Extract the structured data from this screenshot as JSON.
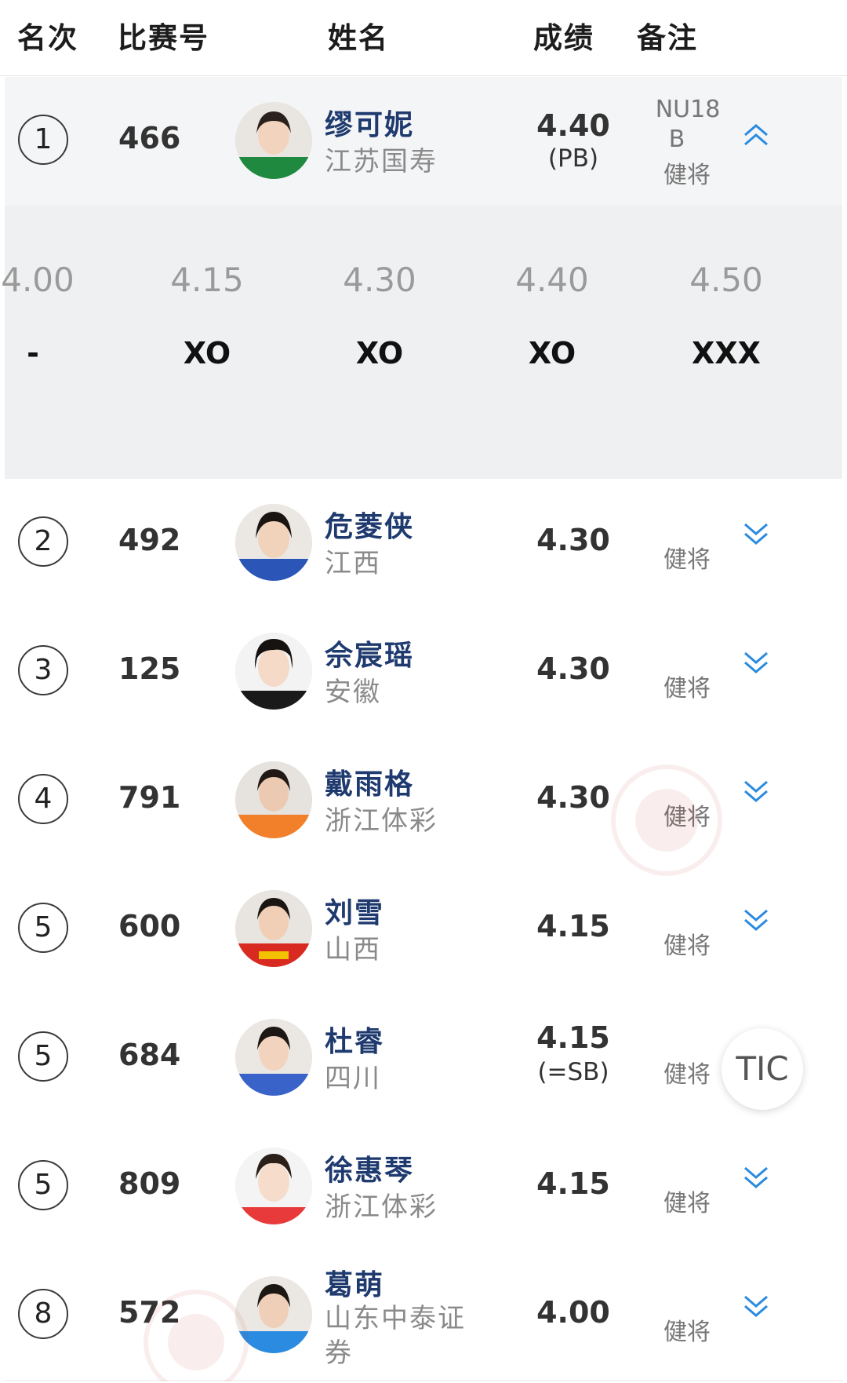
{
  "header": {
    "rank": "名次",
    "bib": "比赛号",
    "name": "姓名",
    "performance": "成绩",
    "remarks": "备注"
  },
  "expanded": {
    "heights": [
      "4.00",
      "4.15",
      "4.30",
      "4.40",
      "4.50"
    ],
    "marks": [
      "-",
      "XO",
      "XO",
      "XO",
      "XXX"
    ]
  },
  "rows": [
    {
      "rank": "1",
      "bib": "466",
      "name": "缪可妮",
      "team": "江苏国寿",
      "perf": "4.40",
      "perf_note": "(PB)",
      "remark1": "NU18",
      "remark2": "B",
      "remark3": "健将",
      "jersey": "#1f8a3f"
    },
    {
      "rank": "2",
      "bib": "492",
      "name": "危菱侠",
      "team": "江西",
      "perf": "4.30",
      "perf_note": "",
      "remark3": "健将",
      "jersey": "#2b56b8"
    },
    {
      "rank": "3",
      "bib": "125",
      "name": "佘宸瑶",
      "team": "安徽",
      "perf": "4.30",
      "perf_note": "",
      "remark3": "健将",
      "jersey": "#1a1a1a"
    },
    {
      "rank": "4",
      "bib": "791",
      "name": "戴雨格",
      "team": "浙江体彩",
      "perf": "4.30",
      "perf_note": "",
      "remark3": "健将",
      "jersey": "#f2802a"
    },
    {
      "rank": "5",
      "bib": "600",
      "name": "刘雪",
      "team": "山西",
      "perf": "4.15",
      "perf_note": "",
      "remark3": "健将",
      "jersey": "#d92a22"
    },
    {
      "rank": "5",
      "bib": "684",
      "name": "杜睿",
      "team": "四川",
      "perf": "4.15",
      "perf_note": "(=SB)",
      "remark3": "健将",
      "jersey": "#3a63c9"
    },
    {
      "rank": "5",
      "bib": "809",
      "name": "徐惠琴",
      "team": "浙江体彩",
      "perf": "4.15",
      "perf_note": "",
      "remark3": "健将",
      "jersey": "#e83a3a"
    },
    {
      "rank": "8",
      "bib": "572",
      "name": "葛萌",
      "team": "山东中泰证券",
      "perf": "4.00",
      "perf_note": "",
      "remark3": "健将",
      "jersey": "#2a8be0"
    }
  ],
  "floating_button": {
    "label": "TIC"
  },
  "icons": {
    "expand": "chevron-double-down-icon",
    "collapse": "chevron-double-up-icon"
  },
  "colors": {
    "name": "#1e3a6e",
    "chevron": "#2a8be0"
  }
}
